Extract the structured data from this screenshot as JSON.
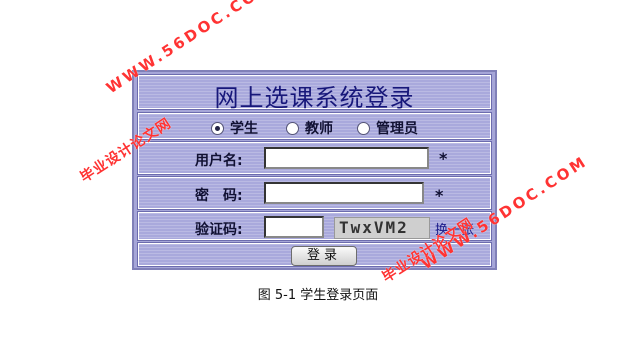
{
  "login": {
    "title": "网上选课系统登录",
    "roles": [
      {
        "label": "学生",
        "checked": true
      },
      {
        "label": "教师",
        "checked": false
      },
      {
        "label": "管理员",
        "checked": false
      }
    ],
    "username_label": "用户名:",
    "username_value": "",
    "password_label": "密　码:",
    "password_value": "",
    "captcha_label": "验证码:",
    "captcha_value": "",
    "captcha_image_text": "TwxVM2",
    "captcha_refresh": "换一张",
    "required_mark": "*",
    "login_button": "登录"
  },
  "caption": "图 5-1  学生登录页面",
  "watermarks": {
    "site": "WWW.56DOC.COM",
    "cn": "毕业设计论文网"
  },
  "colors": {
    "panel": "#a6a6d8",
    "title_text": "#17177a",
    "watermark": "#ff3333"
  }
}
